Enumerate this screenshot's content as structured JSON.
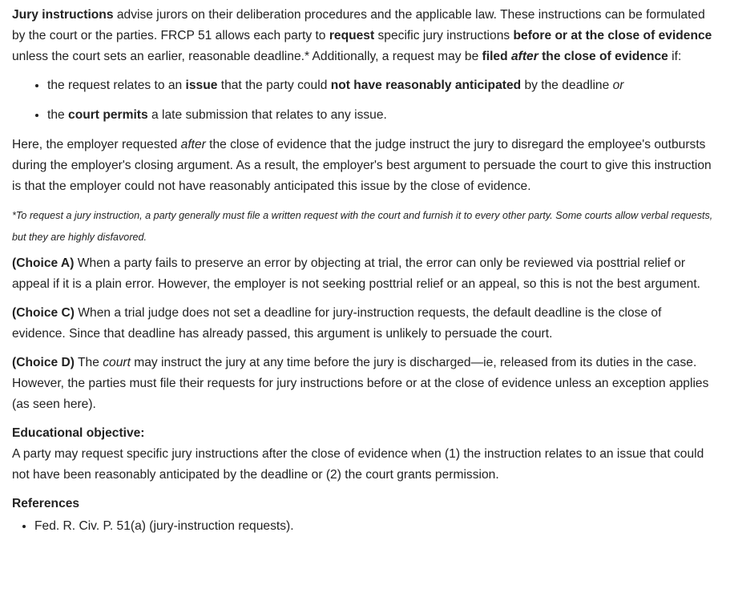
{
  "intro": {
    "t1": "Jury instructions",
    "t2": " advise jurors on their deliberation procedures and the applicable law.  These instructions can be formulated by the court or the parties.  FRCP 51 allows each party to ",
    "t3": "request",
    "t4": " specific jury instructions ",
    "t5": "before or at the close of evidence",
    "t6": " unless the court sets an earlier, reasonable deadline.*  Additionally, a request may be ",
    "t7": "filed ",
    "t8": "after",
    "t9": " the close of evidence",
    "t10": " if:"
  },
  "bullets": [
    {
      "a": "the request relates to an ",
      "b": "issue",
      "c": " that the party could ",
      "d": "not have reasonably anticipated",
      "e": " by the deadline ",
      "f": "or"
    },
    {
      "a": "the ",
      "b": "court permits",
      "c": " a late submission that relates to any issue."
    }
  ],
  "here": {
    "a": "Here, the employer requested ",
    "b": "after",
    "c": " the close of evidence that the judge instruct the jury to disregard the employee's outbursts during the employer's closing argument.  As a result, the employer's best argument to persuade the court to give this instruction is that the employer could not have reasonably anticipated this issue by the close of evidence."
  },
  "footnote": "*To request a jury instruction, a party generally must file a written request with the court and furnish it to every other party.  Some courts allow verbal requests, but they are highly disfavored.",
  "choices": [
    {
      "label": "(Choice A)",
      "text": "  When a party fails to preserve an error by objecting at trial, the error can only be reviewed via posttrial relief or appeal if it is a plain error.  However, the employer is not seeking posttrial relief or an appeal, so this is not the best argument."
    },
    {
      "label": "(Choice C)",
      "text": "  When a trial judge does not set a deadline for jury-instruction requests, the default deadline is the close of evidence.  Since that deadline has already passed, this argument is unlikely to persuade the court."
    }
  ],
  "choice_d": {
    "label": "(Choice D)",
    "a": "  The ",
    "b": "court",
    "c": " may instruct the jury at any time before the jury is discharged—ie, released from its duties in the case.  However, the parties must file their requests for jury instructions before or at the close of evidence unless an exception applies (as seen here)."
  },
  "objective": {
    "heading": "Educational objective:",
    "text": "A party may request specific jury instructions after the close of evidence when (1) the instruction relates to an issue that could not have been reasonably anticipated by the deadline or (2) the court grants permission."
  },
  "references": {
    "heading": "References",
    "items": [
      "Fed. R. Civ. P. 51(a) (jury-instruction requests)."
    ]
  }
}
